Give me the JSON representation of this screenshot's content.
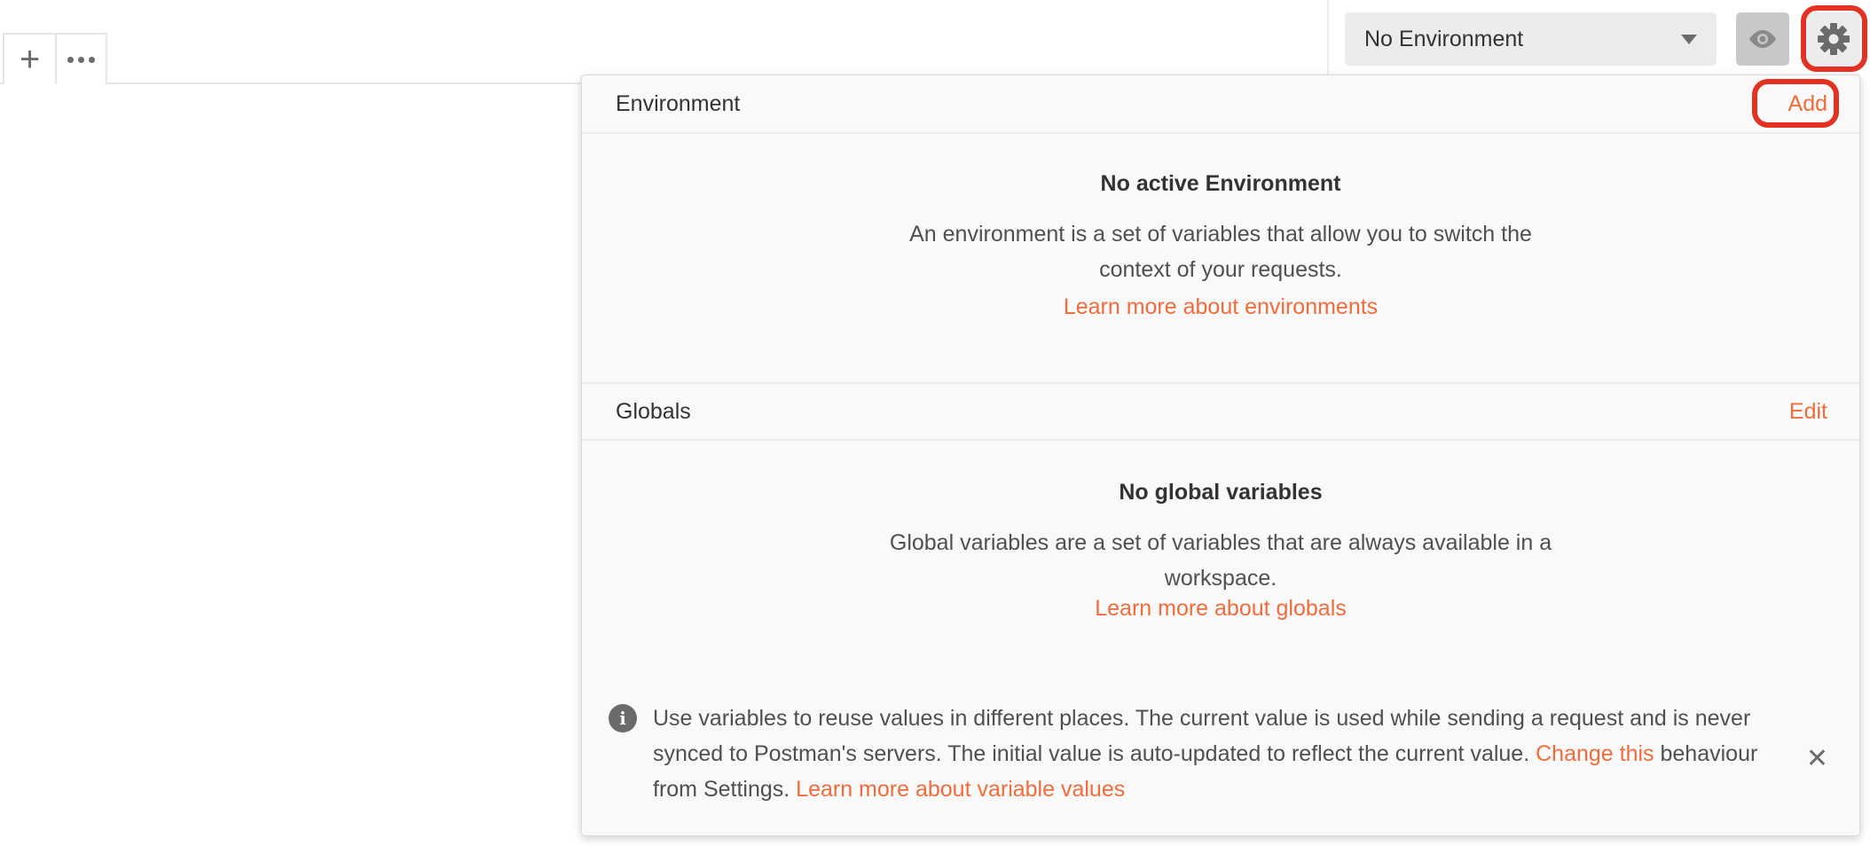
{
  "tabs": {
    "new_tab_icon": "plus-icon",
    "more_icon": "ellipsis-icon"
  },
  "environment_selector": {
    "selected": "No Environment"
  },
  "panel": {
    "environment": {
      "heading": "Environment",
      "action": "Add",
      "empty_title": "No active Environment",
      "empty_line1": "An environment is a set of variables that allow you to switch the",
      "empty_line2": "context of your requests.",
      "learn_more": "Learn more about environments"
    },
    "globals": {
      "heading": "Globals",
      "action": "Edit",
      "empty_title": "No global variables",
      "empty_line1": "Global variables are a set of variables that are always available in a",
      "empty_line2": "workspace.",
      "learn_more": "Learn more about globals"
    },
    "info": {
      "text_part1": "Use variables to reuse values in different places. The current value is used while sending a request and is never synced to Postman's servers. The initial value is auto-updated to reflect the current value. ",
      "change_link": "Change this",
      "text_part2": " behaviour from Settings. ",
      "learn_more": "Learn more about variable values"
    }
  },
  "colors": {
    "accent": "#f26b3a",
    "highlight": "#e53122"
  }
}
